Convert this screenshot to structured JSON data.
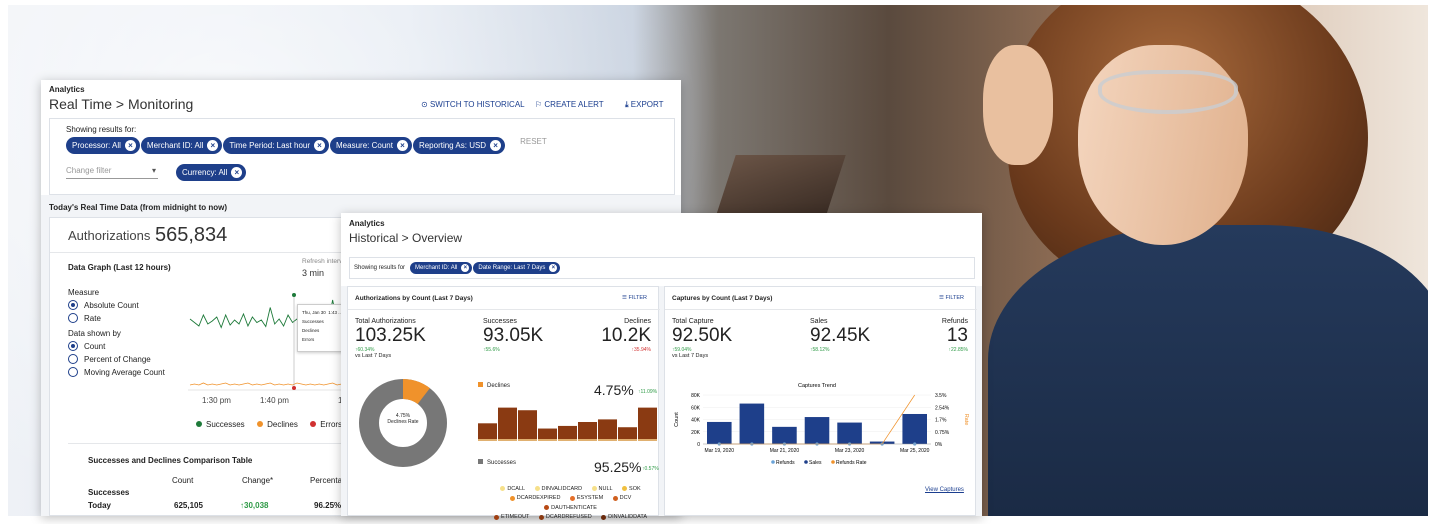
{
  "colors": {
    "accent": "#1e3f8a",
    "success": "#2e9a46",
    "decline": "#f0922b",
    "error": "#d03030",
    "brown": "#8a3a12",
    "grey": "#7a7a7a"
  },
  "monitor": {
    "section": "Analytics",
    "title": "Real Time > Monitoring",
    "actions": {
      "historical": "SWITCH TO HISTORICAL",
      "alert": "CREATE ALERT",
      "export": "EXPORT"
    },
    "showing": "Showing results for:",
    "chips": [
      "Processor: All",
      "Merchant ID: All",
      "Time Period: Last hour",
      "Measure: Count",
      "Reporting As: USD"
    ],
    "reset": "RESET",
    "change_filter": "Change filter",
    "currency_chip": "Currency: All",
    "today_heading": "Today's Real Time Data (from midnight to now)",
    "auth_label": "Authorizations",
    "auth_value": "565,834",
    "graph_title": "Data Graph (Last 12 hours)",
    "refresh_label": "Refresh interval",
    "refresh_value": "3 min",
    "measure_label": "Measure",
    "measure_options": [
      "Absolute Count",
      "Rate"
    ],
    "shown_label": "Data shown by",
    "shown_options": [
      "Count",
      "Percent of Change",
      "Moving Average Count"
    ],
    "tooltip": {
      "date": "Thu, Jan 30",
      "time": "1:43 ...",
      "rows": [
        "Successes",
        "Declines",
        "Errors"
      ]
    },
    "x_ticks": [
      "1:30 pm",
      "1:40 pm",
      "1:5"
    ],
    "legend": [
      "Successes",
      "Declines",
      "Errors"
    ],
    "table_title": "Successes and Declines Comparison Table",
    "table_headers": [
      "Count",
      "Change*",
      "Percentage"
    ],
    "table_group": "Successes",
    "table_row": {
      "label": "Today",
      "count": "625,105",
      "change": "30,038",
      "pct": "96.25%"
    }
  },
  "historical": {
    "section": "Analytics",
    "title": "Historical > Overview",
    "showing": "Showing results for",
    "chips": [
      "Merchant ID: All",
      "Date Range: Last 7 Days"
    ],
    "auth_card": {
      "title": "Authorizations by Count (Last 7 Days)",
      "filter": "FILTER",
      "stats": [
        {
          "label": "Total Authorizations",
          "value": "103.25K",
          "delta": "60.34%",
          "dir": "up",
          "note": "vs Last 7 Days"
        },
        {
          "label": "Successes",
          "value": "93.05K",
          "delta": "55.6%",
          "dir": "up"
        },
        {
          "label": "Declines",
          "value": "10.2K",
          "delta": "35.94%",
          "dir": "down"
        }
      ],
      "donut_center": "4.75%",
      "donut_sub": "Declines Rate",
      "declines_label": "Declines",
      "declines_pct": "4.75%",
      "declines_delta": "11.09%",
      "successes_label": "Successes",
      "successes_pct": "95.25%",
      "successes_delta": "0.57%",
      "legend": [
        "DCALL",
        "DINVALIDCARD",
        "NULL",
        "SOK",
        "DCARDEXPIRED",
        "ESYSTEM",
        "DCV",
        "DAUTHENTICATE",
        "ETIMEOUT",
        "DCARDREFUSED",
        "DINVALIDDATA"
      ]
    },
    "cap_card": {
      "title": "Captures by Count (Last 7 Days)",
      "filter": "FILTER",
      "stats": [
        {
          "label": "Total Capture",
          "value": "92.50K",
          "delta": "59.04%",
          "dir": "up",
          "note": "vs Last 7 Days"
        },
        {
          "label": "Sales",
          "value": "92.45K",
          "delta": "58.12%",
          "dir": "up"
        },
        {
          "label": "Refunds",
          "value": "13",
          "delta": "22.85%",
          "dir": "up"
        }
      ],
      "view_link": "View Captures"
    }
  },
  "chart_data": [
    {
      "type": "bar",
      "title": "Captures Trend",
      "ylabel": "Count",
      "y2label": "Rate",
      "categories": [
        "Mar 19, 2020",
        "Mar 20, 2020",
        "Mar 21, 2020",
        "Mar 22, 2020",
        "Mar 23, 2020",
        "Mar 24, 2020",
        "Mar 25, 2020"
      ],
      "x_ticks": [
        "Mar 19, 2020",
        "Mar 21, 2020",
        "Mar 23, 2020",
        "Mar 25, 2020"
      ],
      "y_ticks": [
        "0",
        "20K",
        "40K",
        "60K",
        "80K"
      ],
      "y2_ticks": [
        "0%",
        "0.75%",
        "1.7%",
        "2.54%",
        "3.5%"
      ],
      "ylim": [
        0,
        80000
      ],
      "y2lim": [
        0,
        3.5
      ],
      "series": [
        {
          "name": "Refunds",
          "values": [
            2,
            1,
            3,
            2,
            1,
            2,
            2
          ]
        },
        {
          "name": "Sales",
          "values": [
            36000,
            66000,
            28000,
            44000,
            35000,
            4000,
            49000
          ]
        },
        {
          "name": "Refunds Rate",
          "values": [
            0,
            0,
            0,
            0,
            0,
            0,
            3.5
          ]
        }
      ],
      "legend": [
        "Refunds",
        "Sales",
        "Refunds Rate"
      ]
    },
    {
      "type": "bar",
      "title": "Declines",
      "values": [
        12,
        24,
        22,
        8,
        10,
        13,
        15,
        9,
        24
      ]
    },
    {
      "type": "bar",
      "title": "Successes",
      "values": [
        22,
        24,
        23,
        24,
        22,
        25,
        23,
        24,
        24
      ]
    },
    {
      "type": "pie",
      "values": [
        4.75,
        95.25
      ],
      "labels": [
        "Declines",
        "Successes"
      ]
    },
    {
      "type": "line",
      "title": "Data Graph (Last 12 hours)",
      "series": [
        {
          "name": "Successes",
          "values": [
            62,
            55,
            48,
            70,
            52,
            58,
            66,
            45,
            70,
            50,
            60,
            52,
            72,
            48,
            66,
            55,
            60,
            47,
            85,
            52,
            62,
            48,
            70,
            55,
            62,
            50,
            70,
            54,
            58,
            48,
            64,
            52,
            100,
            55,
            62,
            48
          ]
        },
        {
          "name": "Declines",
          "values": [
            3,
            4,
            3,
            5,
            3,
            4,
            3,
            4,
            5,
            3,
            4,
            3,
            4,
            5,
            3,
            4,
            3,
            4,
            5,
            3,
            4,
            3,
            4,
            3,
            5,
            4,
            3,
            4,
            3,
            4,
            3,
            4,
            5,
            3,
            4,
            3
          ]
        }
      ]
    }
  ]
}
